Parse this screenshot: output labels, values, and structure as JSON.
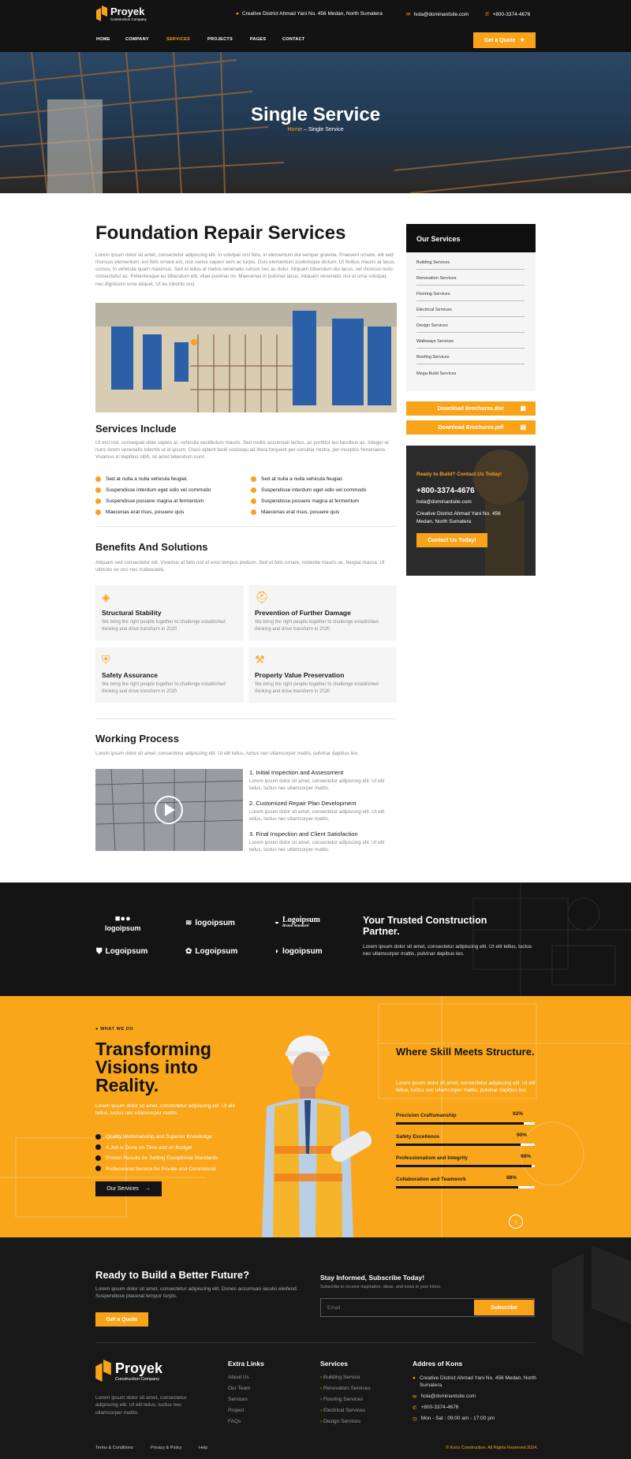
{
  "header": {
    "brand": "Proyek",
    "brand_sub": "Construction Company",
    "address": "Creative District Ahmad Yani No. 456 Medan, North Sumatera",
    "email": "hola@dominantsite.com",
    "phone": "+800-3374-4676",
    "nav": [
      "HOME",
      "COMPANY",
      "SERVICES",
      "PROJECTS",
      "PAGES",
      "CONTACT"
    ],
    "active_nav": "SERVICES",
    "quote_btn": "Get a Quote"
  },
  "hero": {
    "title": "Single Service",
    "crumb_home": "Home",
    "crumb_sep": " – ",
    "crumb_current": "Single Service"
  },
  "main": {
    "title": "Foundation Repair Services",
    "intro": "Lorem ipsum dolor sit amet, consectetur adipiscing elit. In volutpat orci felis, in elementum dui semper gravida. Praesent ornare, elit sed rhoncus elementum, est felis ornare est, non varius sapien sem ac turpis. Duis elementum scelerisque dictum. Ut finibus mauris at lacus cursus, in vehicula quam maximus. Sed id tellus at metus venenatis rutrum nec ac dolor. Aliquam bibendum dui lacus, vel rhoncus nunc consectetur ac. Pellentesque eu bibendum elit, vitae pulvinar mi. Maecenas in pulvinar lacus. Aliquam venenatis nisl ut urna volutpat, nec dignissim urna aliquet. Ut eu lobortis orci.",
    "includes_title": "Services Include",
    "includes_text": "Ut orci nisl, consequat vitae sapien at, vehicula vestibulum mauris. Sed mollis accumsan lectus, ac porttitor leo faucibus ac. Integer et nunc lorem venenatis lobortis ut id ipsum. Class aptent taciti sociosqu ad litora torquent per conubia nostra, per inceptos himenaeos. Vivamus in dapibus nibh, sit amet bibendum nunc.",
    "includes_left": [
      "Sed at nulla a nulla vehicula feugiat.",
      "Suspendisse interdum eget odio vel commodo",
      "Suspendisse posuere magna at fermentum",
      "Maecenas erat risus, posuere quis"
    ],
    "includes_right": [
      "Sed at nulla a nulla vehicula feugiat.",
      "Suspendisse interdum eget odio vel commodo",
      "Suspendisse posuere magna at fermentum",
      "Maecenas erat risus, posuere quis"
    ],
    "benefits_title": "Benefits And Solutions",
    "benefits_text": "Aliquam sed consectetur elit. Vivamus at felis nisl et eros tempus pretium. Sed et felis ornare, molestie mauris ac, feugiat massa. Ut ultricies ex orci nec malesuada.",
    "cards": [
      {
        "title": "Structural Stability",
        "text": "We bring the right people together to challenge established thinking and drive transform in 2020"
      },
      {
        "title": "Prevention of Further Damage",
        "text": "We bring the right people together to challenge established thinking and drive transform in 2020"
      },
      {
        "title": "Safety Assurance",
        "text": "We bring the right people together to challenge established thinking and drive transform in 2020"
      },
      {
        "title": "Property Value Preservation",
        "text": "We bring the right people together to challenge established thinking and drive transform in 2020"
      }
    ],
    "process_title": "Working Process",
    "process_text": "Lorem ipsum dolor sit amet, consectetur adipiscing elit. Ut elit tellus, luctus nec ullamcorper mattis, pulvinar dapibus leo.",
    "steps": [
      {
        "title": "1. Initial Inspection and Assessment",
        "text": "Lorem ipsum dolor sit amet, consectetur adipiscing elit. Ut elit tellus, luctus nec ullamcorper mattis."
      },
      {
        "title": "2. Customized Repair Plan Development",
        "text": "Lorem ipsum dolor sit amet, consectetur adipiscing elit. Ut elit tellus, luctus nec ullamcorper mattis."
      },
      {
        "title": "3. Final Inspection and Client Satisfaction",
        "text": "Lorem ipsum dolor sit amet, consectetur adipiscing elit. Ut elit tellus, luctus nec ullamcorper mattis."
      }
    ]
  },
  "sidebar": {
    "title": "Our Services",
    "items": [
      "Building Services",
      "Renovation Services",
      "Flooring Services",
      "Electrical Services",
      "Design Services",
      "Walkways Services",
      "Roofing Services",
      "Mega-Build Services"
    ],
    "download_doc": "Download Brochures.doc",
    "download_pdf": "Download Brochures.pdf",
    "cta_kicker": "Ready to Build? Contact Us Today!",
    "cta_phone": "+800-3374-4676",
    "cta_email": "hola@dominantsite.com",
    "cta_address": "Creative District Ahmad Yani No. 456 Medan, North Sumatera",
    "cta_btn": "Contact Us Today!"
  },
  "partners": {
    "logos": [
      "logoipsum",
      "logoipsum",
      "Logoipsum",
      "Logoipsum",
      "Logoipsum",
      "logoipsum"
    ],
    "logo_sub": "Brand Standard",
    "title": "Your Trusted Construction Partner.",
    "text": "Lorem ipsum dolor sit amet, consectetur adipiscing elit. Ut elit tellus, luctus nec ullamcorper mattis, pulvinar dapibus leo."
  },
  "whatwedo": {
    "kicker": "WHAT WE DO",
    "title": "Transforming Visions into Reality.",
    "text": "Lorem ipsum dolor sit amet, consectetur adipiscing elit. Ut elit tellus, luctus nec ullamcorper mattis.",
    "list": [
      "Quality Workmanship and Superior Knowledge",
      "A Job is Done on Time and on Budget",
      "Proven Results for Setting Exceptional Standards",
      "Professional Service for Private and Commercial"
    ],
    "btn": "Our Services",
    "skill_title": "Where Skill Meets Structure.",
    "skill_text": "Lorem ipsum dolor sit amet, consectetur adipiscing elit. Ut elit tellus, luctus nec ullamcorper mattis, pulvinar dapibus leo.",
    "skills": [
      {
        "name": "Precision Craftsmanship",
        "pct": "92%",
        "value": 0.92
      },
      {
        "name": "Safety Excellence",
        "pct": "90%",
        "value": 0.9
      },
      {
        "name": "Professionalism and Integrity",
        "pct": "98%",
        "value": 0.98
      },
      {
        "name": "Collaboration and Teamwork",
        "pct": "88%",
        "value": 0.88
      }
    ]
  },
  "footer": {
    "cta_title": "Ready to Build a Better Future?",
    "cta_text": "Lorem ipsum dolor sit amet, consectetur adipiscing elit. Donec accumsan iaculis eleifend. Suspendisse placerat tempor turpis.",
    "cta_btn": "Get a Quote",
    "sub_title": "Stay Informed, Subscribe Today!",
    "sub_text": "Subscribe to receive inspiration, ideas, and news in your inbox.",
    "email_placeholder": "Email",
    "subscribe_btn": "Subscribe",
    "brand": "Proyek",
    "brand_sub": "Construction Company",
    "about": "Lorem ipsum dolor sit amet, consectetur adipiscing elit. Ut elit tellus, luctus nec ullamcorper mattis.",
    "extra_title": "Extra Links",
    "extra": [
      "About Us",
      "Our Team",
      "Services",
      "Project",
      "FAQs"
    ],
    "services_title": "Services",
    "services": [
      "Building Service",
      "Renovation Services",
      "Flooring Services",
      "Electrical Services",
      "Design Services"
    ],
    "address_title": "Addres of Kons",
    "address": "Creative District Ahmad Yani No. 456 Medan, North Sumatera",
    "email": "hola@dominantsite.com",
    "phone": "+800-3374-4676",
    "hours": "Mon - Sat : 09:00 am - 17:00 pm",
    "bottom_links": [
      "Terms & Conditions",
      "Privacy & Policy",
      "Help"
    ],
    "copyright": "© Kons Construction. All Rights Reserved 2024."
  },
  "colors": {
    "accent": "#f9a31a",
    "dark": "#131313"
  }
}
